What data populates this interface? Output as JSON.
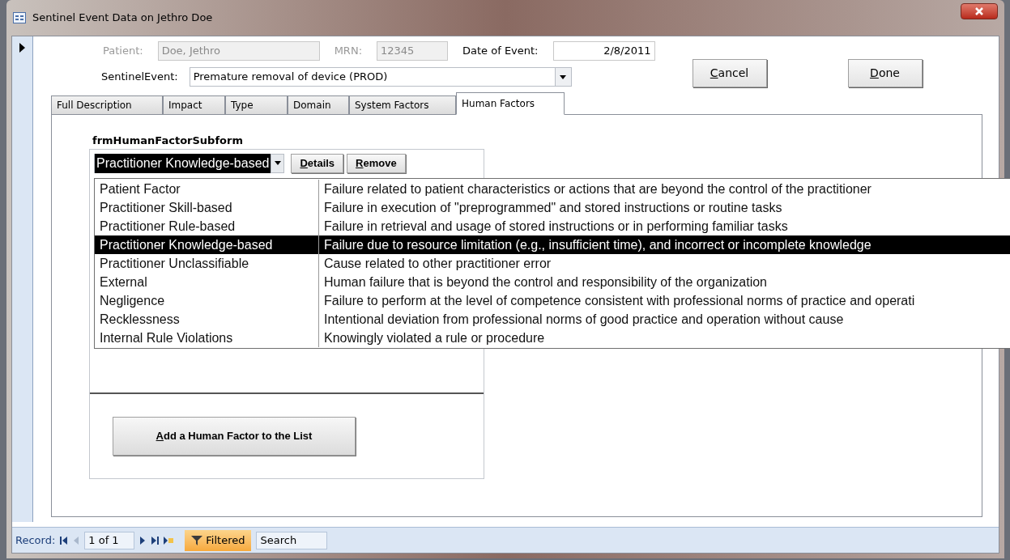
{
  "window": {
    "title": "Sentinel Event Data on Jethro Doe"
  },
  "fields": [
    {
      "label": "Patient:",
      "value": "Doe, Jethro",
      "disabled": true
    },
    {
      "label": "MRN:",
      "value": "12345",
      "disabled": true
    },
    {
      "label": "Date of Event:",
      "value": "2/8/2011",
      "disabled": false
    }
  ],
  "sentinel_event": {
    "label": "SentinelEvent:",
    "value": "Premature removal of device (PROD)"
  },
  "buttons": [
    {
      "label": "Cancel"
    },
    {
      "label": "Done"
    }
  ],
  "tabs": [
    {
      "label": "Full Description",
      "selected": false
    },
    {
      "label": "Impact",
      "selected": false
    },
    {
      "label": "Type",
      "selected": false
    },
    {
      "label": "Domain",
      "selected": false
    },
    {
      "label": "System Factors",
      "selected": false
    },
    {
      "label": "Human Factors",
      "selected": true
    }
  ],
  "subform": {
    "label": "frmHumanFactorSubform",
    "combo_value": "Practitioner Knowledge-based",
    "buttons": [
      {
        "label": "Details"
      },
      {
        "label": "Remove"
      }
    ],
    "dropdown": [
      {
        "name": "Patient Factor",
        "description": "Failure related to patient characteristics or actions that are beyond the control of the practitioner",
        "selected": false
      },
      {
        "name": "Practitioner Skill-based",
        "description": "Failure in execution of \"preprogrammed\" and stored instructions or routine tasks",
        "selected": false
      },
      {
        "name": "Practitioner Rule-based",
        "description": "Failure in retrieval and usage of stored instructions or in performing familiar tasks",
        "selected": false
      },
      {
        "name": "Practitioner Knowledge-based",
        "description": "Failure due to resource limitation (e.g., insufficient time), and incorrect or incomplete knowledge",
        "selected": true
      },
      {
        "name": "Practitioner Unclassifiable",
        "description": "Cause related to other practitioner error",
        "selected": false
      },
      {
        "name": "External",
        "description": "Human failure that is beyond the control and responsibility of the organization",
        "selected": false
      },
      {
        "name": "Negligence",
        "description": "Failure to perform at the level of competence consistent with professional norms of practice and operati",
        "selected": false
      },
      {
        "name": "Recklessness",
        "description": "Intentional deviation from professional norms of good practice and operation without cause",
        "selected": false
      },
      {
        "name": "Internal Rule Violations",
        "description": "Knowingly violated a rule or procedure",
        "selected": false
      }
    ],
    "add_button": {
      "label": "Add a Human Factor to the List"
    }
  },
  "status_bar": {
    "label": "Record:",
    "position": "1 of 1",
    "filter": "Filtered",
    "search": {
      "placeholder": "Search"
    }
  }
}
